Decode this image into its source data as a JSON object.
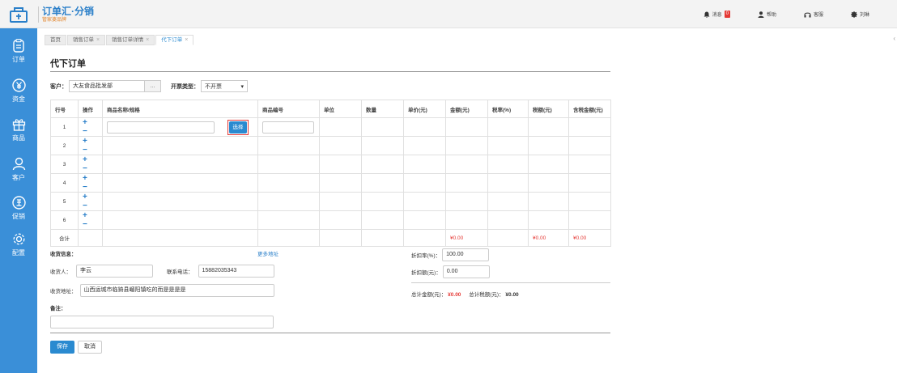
{
  "brand": {
    "title": "订单汇·分销",
    "subtitle": "管家婆品牌"
  },
  "top_actions": [
    {
      "label": "消息",
      "badge": "0",
      "icon": "bell-icon"
    },
    {
      "label": "帮助",
      "icon": "user-icon"
    },
    {
      "label": "客服",
      "icon": "headset-icon"
    },
    {
      "label": "刘琳",
      "icon": "gear-icon"
    }
  ],
  "sidebar": [
    {
      "label": "订单",
      "icon": "order-icon"
    },
    {
      "label": "资金",
      "icon": "money-icon"
    },
    {
      "label": "商品",
      "icon": "gift-icon"
    },
    {
      "label": "客户",
      "icon": "person-icon"
    },
    {
      "label": "促销",
      "icon": "promo-icon"
    },
    {
      "label": "配置",
      "icon": "gear-icon"
    }
  ],
  "tabs": [
    {
      "label": "首页",
      "closable": false
    },
    {
      "label": "销售订单",
      "closable": true
    },
    {
      "label": "销售订单详情",
      "closable": true
    },
    {
      "label": "代下订单",
      "closable": true,
      "active": true
    }
  ],
  "page_title": "代下订单",
  "filter": {
    "customer_label": "客户：",
    "customer_value": "大友食品批发部",
    "dots": "...",
    "invoice_label": "开票类型：",
    "invoice_value": "不开票"
  },
  "table": {
    "headers": [
      "行号",
      "操作",
      "商品名称/规格",
      "商品编号",
      "单位",
      "数量",
      "单价(元)",
      "金额(元)",
      "税率(%)",
      "税额(元)",
      "含税金额(元)"
    ],
    "rows": [
      "1",
      "2",
      "3",
      "4",
      "5",
      "6"
    ],
    "ops": "+ −",
    "pick_label": "选择",
    "total_label": "合计",
    "total_amount": "¥0.00",
    "total_tax": "¥0.00",
    "total_with_tax": "¥0.00"
  },
  "shipping": {
    "header": "收货信息：",
    "more": "更多地址",
    "receiver_label": "收货人：",
    "receiver_value": "李云",
    "phone_label": "联系电话：",
    "phone_value": "15882035343",
    "address_label": "收货地址：",
    "address_value": "山西运城市临猗县嵋阳镇吃的而是是是是",
    "remark_label": "备注：",
    "remark_value": ""
  },
  "discount": {
    "rate_label": "折扣率(%)：",
    "rate_value": "100.00",
    "amount_label": "折扣额(元)：",
    "amount_value": "0.00",
    "total_label": "总计金额(元)：",
    "total_value": "¥0.00",
    "tax_label": "总计税额(元)：",
    "tax_value": "¥0.00"
  },
  "buttons": {
    "save": "保存",
    "cancel": "取消"
  },
  "colors": {
    "sidebar": "#3a8fd8",
    "accent": "#2a8ad0",
    "money": "#e53935",
    "brand_sub": "#e3862e"
  }
}
